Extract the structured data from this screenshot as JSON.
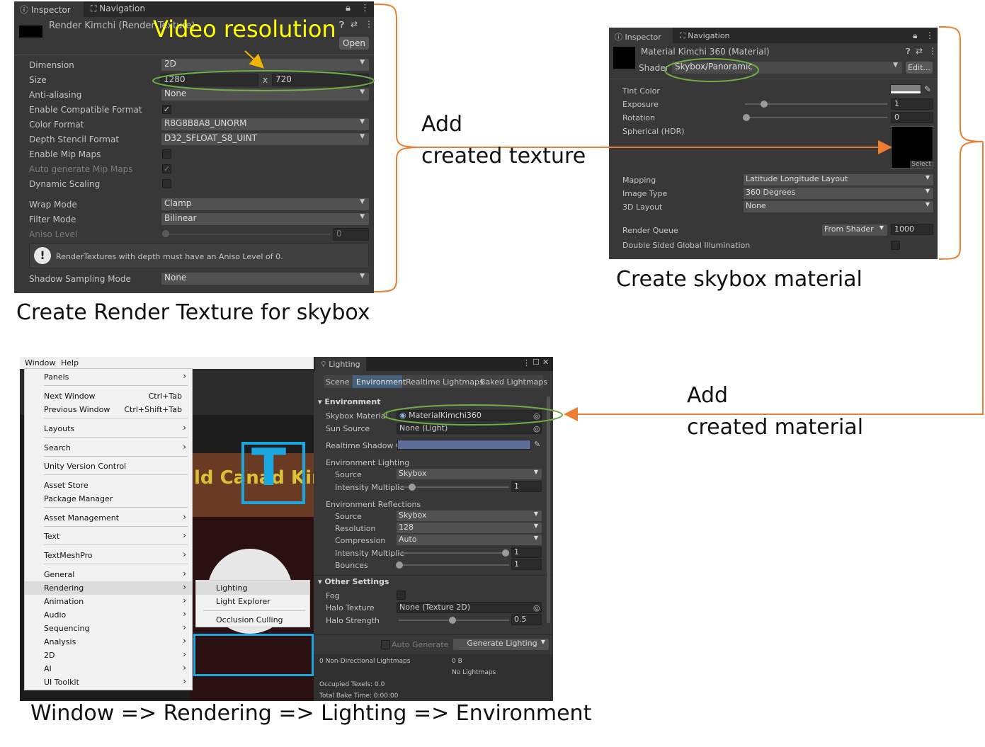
{
  "annotation_colors": {
    "bracket": "#ed7d31",
    "ellipse": "#70ad47",
    "highlight": "#ffff00",
    "arrow_yellow": "#f2b600"
  },
  "captions": {
    "render_texture": "Create Render Texture for skybox",
    "skybox_material": "Create skybox material",
    "window_path": "Window => Rendering => Lighting => Environment",
    "add_texture_line1": "Add",
    "add_texture_line2": "created texture",
    "add_material_line1": "Add",
    "add_material_line2": "created material",
    "video_resolution": "Video resolution"
  },
  "rt_panel": {
    "tab_inspector": "Inspector",
    "tab_navigation": "Navigation",
    "title": "Render Kimchi (Render Texture)",
    "open_button": "Open",
    "dimension_label": "Dimension",
    "dimension_value": "2D",
    "size_label": "Size",
    "size_w": "1280",
    "size_x": "x",
    "size_h": "720",
    "aa_label": "Anti-aliasing",
    "aa_value": "None",
    "compat_label": "Enable Compatible Format",
    "colorfmt_label": "Color Format",
    "colorfmt_value": "R8G8B8A8_UNORM",
    "depth_label": "Depth Stencil Format",
    "depth_value": "D32_SFLOAT_S8_UINT",
    "mip_label": "Enable Mip Maps",
    "automip_label": "Auto generate Mip Maps",
    "dynscale_label": "Dynamic Scaling",
    "wrap_label": "Wrap Mode",
    "wrap_value": "Clamp",
    "filter_label": "Filter Mode",
    "filter_value": "Bilinear",
    "aniso_label": "Aniso Level",
    "aniso_value": "0",
    "warning": "RenderTextures with depth must have an Aniso Level of 0.",
    "shadow_label": "Shadow Sampling Mode",
    "shadow_value": "None",
    "check": "✓"
  },
  "mat_panel": {
    "tab_inspector": "Inspector",
    "tab_navigation": "Navigation",
    "title": "Material Kimchi 360 (Material)",
    "shader_label": "Shader",
    "shader_value": "Skybox/Panoramic",
    "edit_button": "Edit...",
    "tint_label": "Tint Color",
    "exposure_label": "Exposure",
    "exposure_value": "1",
    "rotation_label": "Rotation",
    "rotation_value": "0",
    "spherical_label": "Spherical  (HDR)",
    "select_label": "Select",
    "mapping_label": "Mapping",
    "mapping_value": "Latitude Longitude Layout",
    "imagetype_label": "Image Type",
    "imagetype_value": "360 Degrees",
    "layout3d_label": "3D Layout",
    "layout3d_value": "None",
    "queue_label": "Render Queue",
    "queue_mode": "From Shader",
    "queue_value": "1000",
    "dsgi_label": "Double Sided Global Illumination"
  },
  "window_menu": {
    "menubar": [
      "Window",
      "Help"
    ],
    "items": [
      {
        "label": "Panels",
        "shortcut": "",
        "sub": true
      },
      {
        "label": "Next Window",
        "shortcut": "Ctrl+Tab",
        "sub": false
      },
      {
        "label": "Previous Window",
        "shortcut": "Ctrl+Shift+Tab",
        "sub": false
      },
      {
        "label": "Layouts",
        "shortcut": "",
        "sub": true
      },
      {
        "label": "Search",
        "shortcut": "",
        "sub": true
      },
      {
        "label": "Unity Version Control",
        "shortcut": "",
        "sub": false
      },
      {
        "label": "Asset Store",
        "shortcut": "",
        "sub": false
      },
      {
        "label": "Package Manager",
        "shortcut": "",
        "sub": false
      },
      {
        "label": "Asset Management",
        "shortcut": "",
        "sub": true
      },
      {
        "label": "Text",
        "shortcut": "",
        "sub": true
      },
      {
        "label": "TextMeshPro",
        "shortcut": "",
        "sub": true
      },
      {
        "label": "General",
        "shortcut": "",
        "sub": true
      },
      {
        "label": "Rendering",
        "shortcut": "",
        "sub": true
      },
      {
        "label": "Animation",
        "shortcut": "",
        "sub": true
      },
      {
        "label": "Audio",
        "shortcut": "",
        "sub": true
      },
      {
        "label": "Sequencing",
        "shortcut": "",
        "sub": true
      },
      {
        "label": "Analysis",
        "shortcut": "",
        "sub": true
      },
      {
        "label": "2D",
        "shortcut": "",
        "sub": true
      },
      {
        "label": "AI",
        "shortcut": "",
        "sub": true
      },
      {
        "label": "UI Toolkit",
        "shortcut": "",
        "sub": true
      }
    ],
    "submenu": [
      "Lighting",
      "Light Explorer",
      "Occlusion Culling"
    ],
    "chevron": "›"
  },
  "scene_text": "ld Canad Kim",
  "scene_letter": "T",
  "lighting": {
    "title": "Lighting",
    "tabs": [
      "Scene",
      "Environment",
      "Realtime Lightmaps",
      "Baked Lightmaps"
    ],
    "active_tab": 1,
    "env_header": "Environment",
    "skybox_label": "Skybox Material",
    "skybox_value": "MaterialKimchi360",
    "sun_label": "Sun Source",
    "sun_value": "None (Light)",
    "shadow_label": "Realtime Shadow Cc",
    "envlight_header": "Environment Lighting",
    "source_label": "Source",
    "source_value": "Skybox",
    "intensity_label": "Intensity Multiplie",
    "intensity_value": "1",
    "envrefl_header": "Environment Reflections",
    "rsource_label": "Source",
    "rsource_value": "Skybox",
    "resolution_label": "Resolution",
    "resolution_value": "128",
    "compression_label": "Compression",
    "compression_value": "Auto",
    "rintensity_label": "Intensity Multiplie",
    "rintensity_value": "1",
    "bounces_label": "Bounces",
    "bounces_value": "1",
    "other_header": "Other Settings",
    "fog_label": "Fog",
    "halotex_label": "Halo Texture",
    "halotex_value": "None (Texture 2D)",
    "halostr_label": "Halo Strength",
    "halostr_value": "0.5",
    "auto_generate": "Auto Generate",
    "generate_button": "Generate Lighting",
    "stats_left": "0 Non-Directional Lightmaps",
    "stats_size": "0 B",
    "stats_nolight": "No Lightmaps",
    "occupied": "Occupied Texels: 0.0",
    "bake_time": "Total Bake Time: 0:00:00"
  }
}
